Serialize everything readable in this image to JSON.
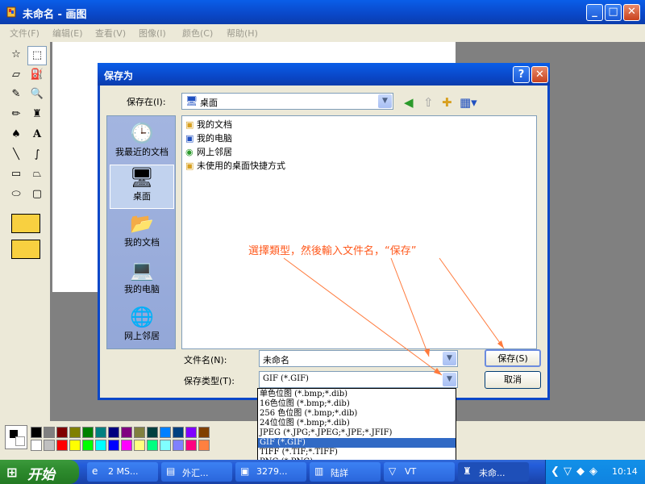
{
  "window": {
    "title": "未命名 - 画图",
    "menu": [
      "文件(F)",
      "编辑(E)",
      "查看(V)",
      "图像(I)",
      "颜色(C)",
      "帮助(H)"
    ]
  },
  "dialog": {
    "title": "保存为",
    "save_in_label": "保存在(I):",
    "save_in_value": "桌面",
    "places": [
      "我最近的文档",
      "桌面",
      "我的文档",
      "我的电脑",
      "网上邻居"
    ],
    "files": [
      "我的文档",
      "我的电脑",
      "网上邻居",
      "未使用的桌面快捷方式"
    ],
    "filename_label": "文件名(N):",
    "filename_value": "未命名",
    "filetype_label": "保存类型(T):",
    "filetype_value": "GIF (*.GIF)",
    "save_button": "保存(S)",
    "cancel_button": "取消",
    "filetype_options": [
      "单色位图 (*.bmp;*.dib)",
      "16色位图 (*.bmp;*.dib)",
      "256 色位图 (*.bmp;*.dib)",
      "24位位图 (*.bmp;*.dib)",
      "JPEG (*.JPG;*.JPEG;*.JPE;*.JFIF)",
      "GIF (*.GIF)",
      "TIFF (*.TIF;*.TIFF)",
      "PNG (*.PNG)"
    ],
    "selected_filetype_index": 5
  },
  "annotation": "選擇類型，然後輸入文件名，“保存”",
  "taskbar": {
    "start_label": "开始",
    "tasks": [
      "2 MS...",
      "外汇...",
      "3279...",
      "陆詳",
      "VT",
      "未命..."
    ],
    "clock": "10:14"
  },
  "palette": {
    "row1": [
      "#000000",
      "#808080",
      "#800000",
      "#808000",
      "#008000",
      "#008080",
      "#000080",
      "#800080",
      "#808040",
      "#004040",
      "#0080ff",
      "#004080",
      "#8000ff",
      "#804000"
    ],
    "row2": [
      "#ffffff",
      "#c0c0c0",
      "#ff0000",
      "#ffff00",
      "#00ff00",
      "#00ffff",
      "#0000ff",
      "#ff00ff",
      "#ffff80",
      "#00ff80",
      "#80ffff",
      "#8080ff",
      "#ff0080",
      "#ff8040"
    ]
  }
}
